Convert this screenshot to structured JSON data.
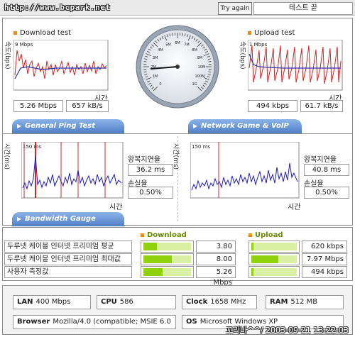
{
  "header": {
    "url": "http://www.bcpark.net",
    "try_again": "Try again",
    "end_test": "테스트 끝"
  },
  "download": {
    "title": "Download test",
    "y_axis": "속도(bps)",
    "scale": "9 Mbps",
    "x_axis": "시간",
    "mbps": "5.26 Mbps",
    "kbs": "657 kB/s"
  },
  "upload": {
    "title": "Upload test",
    "y_axis": "속도(bps)",
    "scale": "1 Mbps",
    "x_axis": "시간",
    "kbps": "494 kbps",
    "kbs": "61.7 kB/s"
  },
  "gauge": {
    "ticks": [
      "0",
      "1M",
      "2M",
      "3M",
      "4M",
      "5M",
      "6M",
      "7M",
      "8M",
      "9M",
      "10M",
      "100M",
      "1G"
    ]
  },
  "ping": {
    "tab": "General Ping Test",
    "y_axis": "시간(ms)",
    "scale": "150 ms",
    "x_axis": "시간",
    "rtt_label": "왕복지연율",
    "rtt_value": "36.2 ms",
    "loss_label": "손실율",
    "loss_value": "0.50%"
  },
  "game": {
    "tab": "Network Game & VoIP Test",
    "y_axis": "시간(ms)",
    "scale": "150 ms",
    "x_axis": "시간",
    "rtt_label": "왕복지연율",
    "rtt_value": "40.8 ms",
    "loss_label": "손실율",
    "loss_value": "0.50%"
  },
  "bandwidth": {
    "tab": "Bandwidth Gauge",
    "download_header": "Download",
    "upload_header": "Upload",
    "rows": [
      {
        "label": "두루넷 케이블 인터넷 프리미엄 평균",
        "down": "3.80 Mbps",
        "down_frac": 0.28,
        "up": "620 kbps",
        "up_frac": 0.05
      },
      {
        "label": "두루넷 케이블 인터넷 프리미엄 최대값",
        "down": "8.00 Mbps",
        "down_frac": 0.6,
        "up": "7.97 Mbps",
        "up_frac": 0.6
      },
      {
        "label": "사용자 측정값",
        "down": "5.26 Mbps",
        "down_frac": 0.4,
        "up": "494 kbps",
        "up_frac": 0.04
      }
    ]
  },
  "system": {
    "lan_label": "LAN",
    "lan_value": "400 Mbps",
    "cpu_label": "CPU",
    "cpu_value": "586",
    "clock_label": "Clock",
    "clock_value": "1658 MHz",
    "ram_label": "RAM",
    "ram_value": "512 MB",
    "browser_label": "Browser",
    "browser_value": "Mozilla/4.0 (compatible; MSIE 6.0",
    "os_label": "OS",
    "os_value": "Microsoft Windows XP"
  },
  "watermark": "꼬리바^^/ 2003-09-21 13:22:03",
  "colors": {
    "accent": "#4f7fc7",
    "bar_fill": "#8fd10a",
    "header_square": "#f28b00",
    "download_line": "#e02020",
    "avg_line": "#2233aa",
    "ping_line": "#1a1acc"
  }
}
